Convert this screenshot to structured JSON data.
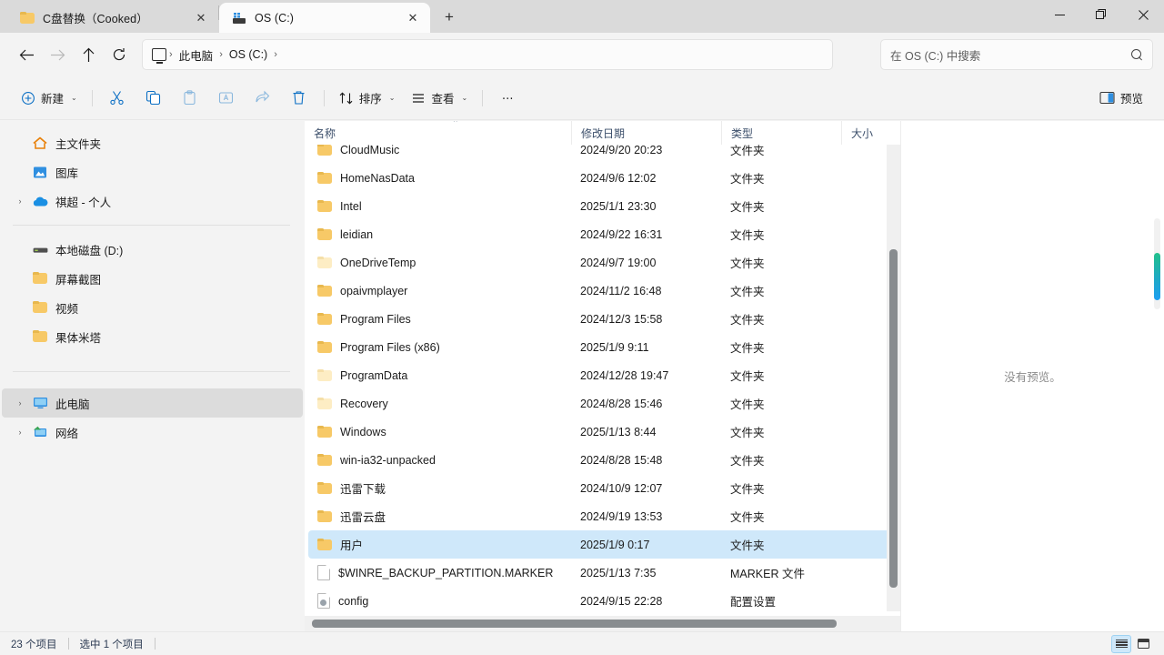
{
  "window": {
    "minimize_label": "–",
    "restore_label": "❐",
    "close_label": "✕"
  },
  "tabs": [
    {
      "label": "C盘替换（Cooked）",
      "icon": "folder-icon",
      "close_label": "✕",
      "active": false
    },
    {
      "label": "OS (C:)",
      "icon": "drive-icon",
      "close_label": "✕",
      "active": true
    }
  ],
  "new_tab_label": "+",
  "nav": {
    "back_label": "←",
    "forward_label": "→",
    "up_label": "↑",
    "refresh_label": "⟳",
    "breadcrumbs": [
      "此电脑",
      "OS (C:)"
    ],
    "separator": "›"
  },
  "search": {
    "placeholder": "在 OS (C:) 中搜索",
    "value": "",
    "icon": "search-icon"
  },
  "toolbar": {
    "new_label": "新建",
    "cut_label": "剪切",
    "copy_label": "复制",
    "paste_label": "粘贴",
    "rename_label": "重命名",
    "share_label": "共享",
    "delete_label": "删除",
    "sort_label": "排序",
    "view_label": "查看",
    "more_label": "⋯",
    "preview_label": "预览",
    "chevron": "⌄"
  },
  "sidebar": {
    "items": [
      {
        "label": "主文件夹",
        "icon": "home-icon",
        "expandable": false,
        "selected": false
      },
      {
        "label": "图库",
        "icon": "gallery-icon",
        "expandable": false,
        "selected": false
      },
      {
        "label": "祺超 - 个人",
        "icon": "onedrive-icon",
        "expandable": true,
        "selected": false
      }
    ],
    "items2": [
      {
        "label": "本地磁盘 (D:)",
        "icon": "drive-icon",
        "expandable": false,
        "selected": false
      },
      {
        "label": "屏幕截图",
        "icon": "folder-icon",
        "expandable": false,
        "selected": false
      },
      {
        "label": "视频",
        "icon": "folder-icon",
        "expandable": false,
        "selected": false
      },
      {
        "label": "果体米塔",
        "icon": "folder-icon",
        "expandable": false,
        "selected": false
      }
    ],
    "items3": [
      {
        "label": "此电脑",
        "icon": "this-pc-icon",
        "expandable": true,
        "selected": true
      },
      {
        "label": "网络",
        "icon": "network-icon",
        "expandable": true,
        "selected": false
      }
    ],
    "expander_glyph": "›"
  },
  "filelist": {
    "columns": [
      {
        "label": "名称",
        "key": "name"
      },
      {
        "label": "修改日期",
        "key": "date"
      },
      {
        "label": "类型",
        "key": "type"
      },
      {
        "label": "大小",
        "key": "size"
      }
    ],
    "sort_indicator": "⌃",
    "rows": [
      {
        "name": "CloudMusic",
        "date": "2024/9/20 20:23",
        "type": "文件夹",
        "size": "",
        "icon": "folder-icon",
        "dim": false,
        "selected": false
      },
      {
        "name": "HomeNasData",
        "date": "2024/9/6 12:02",
        "type": "文件夹",
        "size": "",
        "icon": "folder-icon",
        "dim": false,
        "selected": false
      },
      {
        "name": "Intel",
        "date": "2025/1/1 23:30",
        "type": "文件夹",
        "size": "",
        "icon": "folder-icon",
        "dim": false,
        "selected": false
      },
      {
        "name": "leidian",
        "date": "2024/9/22 16:31",
        "type": "文件夹",
        "size": "",
        "icon": "folder-icon",
        "dim": false,
        "selected": false
      },
      {
        "name": "OneDriveTemp",
        "date": "2024/9/7 19:00",
        "type": "文件夹",
        "size": "",
        "icon": "folder-icon",
        "dim": true,
        "selected": false
      },
      {
        "name": "opaivmplayer",
        "date": "2024/11/2 16:48",
        "type": "文件夹",
        "size": "",
        "icon": "folder-icon",
        "dim": false,
        "selected": false
      },
      {
        "name": "Program Files",
        "date": "2024/12/3 15:58",
        "type": "文件夹",
        "size": "",
        "icon": "folder-icon",
        "dim": false,
        "selected": false
      },
      {
        "name": "Program Files (x86)",
        "date": "2025/1/9 9:11",
        "type": "文件夹",
        "size": "",
        "icon": "folder-icon",
        "dim": false,
        "selected": false
      },
      {
        "name": "ProgramData",
        "date": "2024/12/28 19:47",
        "type": "文件夹",
        "size": "",
        "icon": "folder-icon",
        "dim": true,
        "selected": false
      },
      {
        "name": "Recovery",
        "date": "2024/8/28 15:46",
        "type": "文件夹",
        "size": "",
        "icon": "folder-icon",
        "dim": true,
        "selected": false
      },
      {
        "name": "Windows",
        "date": "2025/1/13 8:44",
        "type": "文件夹",
        "size": "",
        "icon": "folder-icon",
        "dim": false,
        "selected": false
      },
      {
        "name": "win-ia32-unpacked",
        "date": "2024/8/28 15:48",
        "type": "文件夹",
        "size": "",
        "icon": "folder-icon",
        "dim": false,
        "selected": false
      },
      {
        "name": "迅雷下载",
        "date": "2024/10/9 12:07",
        "type": "文件夹",
        "size": "",
        "icon": "folder-icon",
        "dim": false,
        "selected": false
      },
      {
        "name": "迅雷云盘",
        "date": "2024/9/19 13:53",
        "type": "文件夹",
        "size": "",
        "icon": "folder-icon",
        "dim": false,
        "selected": false
      },
      {
        "name": "用户",
        "date": "2025/1/9 0:17",
        "type": "文件夹",
        "size": "",
        "icon": "folder-icon",
        "dim": false,
        "selected": true
      },
      {
        "name": "$WINRE_BACKUP_PARTITION.MARKER",
        "date": "2025/1/13 7:35",
        "type": "MARKER 文件",
        "size": "",
        "icon": "file-icon",
        "dim": false,
        "selected": false
      },
      {
        "name": "config",
        "date": "2024/9/15 22:28",
        "type": "配置设置",
        "size": "",
        "icon": "config-file-icon",
        "dim": false,
        "selected": false
      }
    ]
  },
  "preview": {
    "empty_text": "没有预览。"
  },
  "status": {
    "item_count": "23 个项目",
    "selected_count": "选中 1 个项目",
    "details_view_label": "详细信息",
    "tiles_view_label": "大图标"
  },
  "colors": {
    "accent": "#0078d4",
    "selection": "#cfe8fa",
    "folder": "#f7c967",
    "titlebar": "#dadada",
    "chrome": "#f3f3f3"
  }
}
